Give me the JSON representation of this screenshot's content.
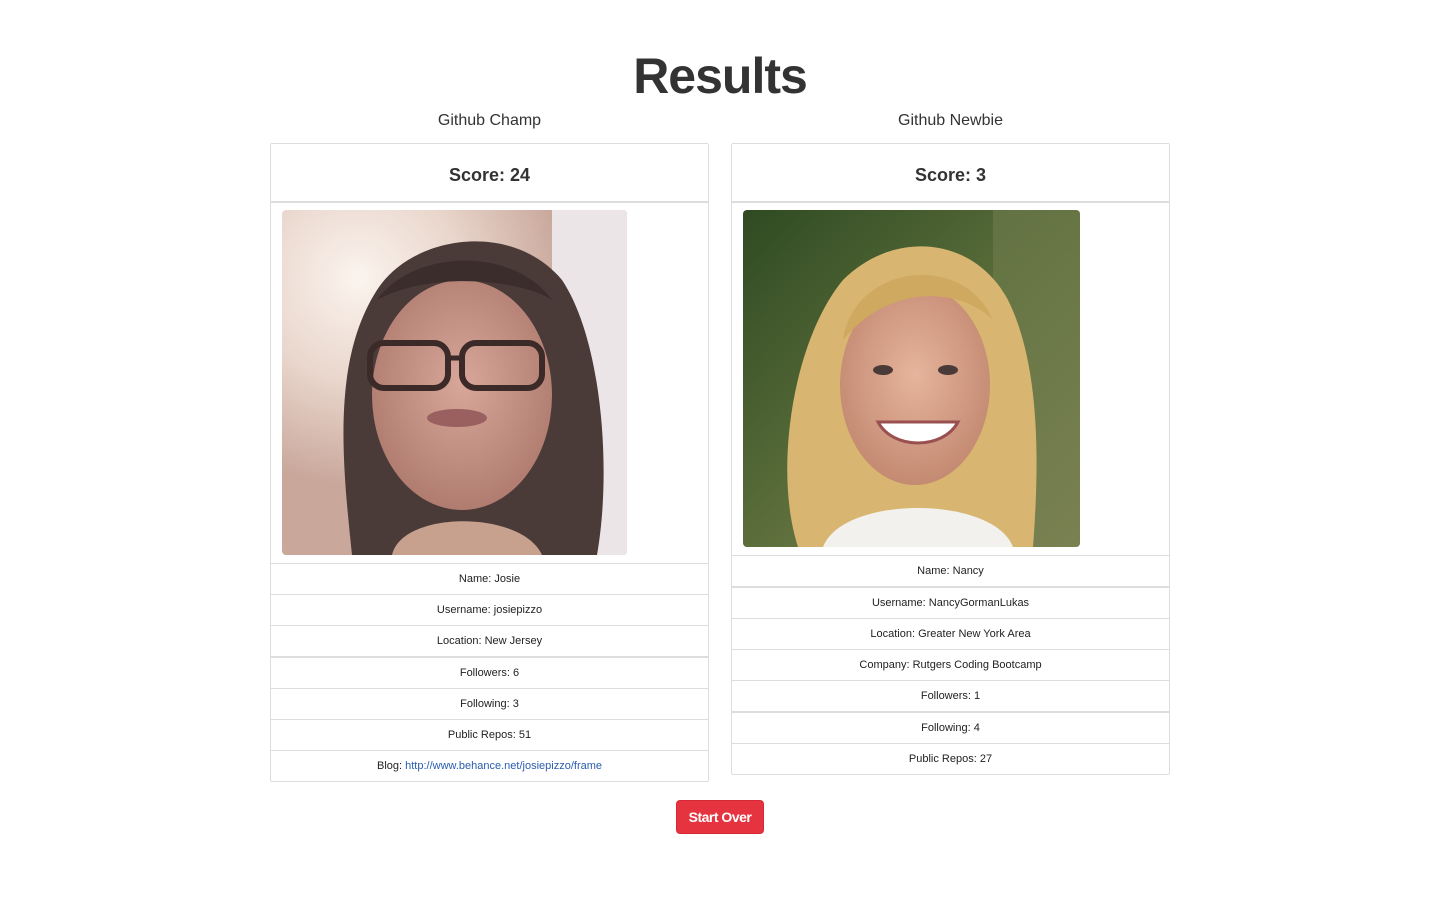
{
  "page": {
    "title": "Results"
  },
  "players": [
    {
      "heading": "Github Champ",
      "score": "Score: 24",
      "avatar_alt": "Josie avatar",
      "rows": {
        "name": "Name: Josie",
        "username": "Username: josiepizzo",
        "location": "Location: New Jersey",
        "followers": "Followers: 6",
        "following": "Following: 3",
        "public_repos": "Public Repos: 51",
        "blog_label": "Blog: ",
        "blog_link": "http://www.behance.net/josiepizzo/frame"
      }
    },
    {
      "heading": "Github Newbie",
      "score": "Score: 3",
      "avatar_alt": "Nancy avatar",
      "rows": {
        "name": "Name: Nancy",
        "username": "Username: NancyGormanLukas",
        "location": "Location: Greater New York Area",
        "company": "Company: Rutgers Coding Bootcamp",
        "followers": "Followers: 1",
        "following": "Following: 4",
        "public_repos": "Public Repos: 27"
      }
    }
  ],
  "actions": {
    "start_over_label": "Start Over"
  },
  "colors": {
    "button_bg": "#e5343f",
    "link": "#2a5db0",
    "border": "#dddddd"
  }
}
